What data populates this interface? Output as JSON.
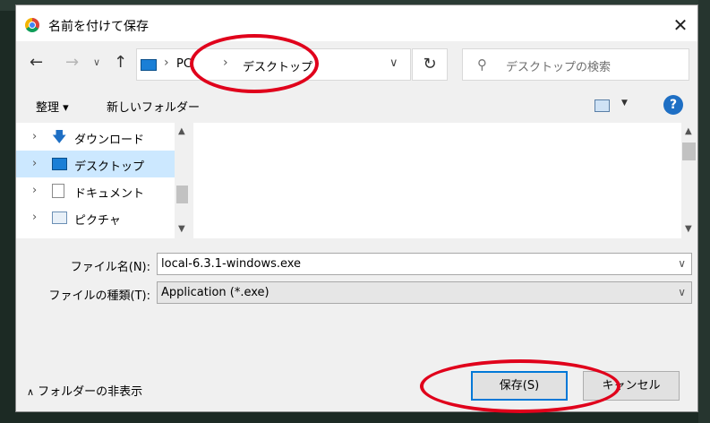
{
  "dialog": {
    "title": "名前を付けて保存"
  },
  "address": {
    "crumb_pc": "PC",
    "crumb_desktop": "デスクトップ"
  },
  "search": {
    "placeholder": "デスクトップの検索"
  },
  "toolbar": {
    "organize": "整理 ▾",
    "new_folder": "新しいフォルダー"
  },
  "tree": {
    "items": [
      {
        "label": "ダウンロード",
        "icon": "download-icon"
      },
      {
        "label": "デスクトップ",
        "icon": "desktop-icon",
        "selected": true
      },
      {
        "label": "ドキュメント",
        "icon": "documents-icon"
      },
      {
        "label": "ピクチャ",
        "icon": "pictures-icon"
      }
    ]
  },
  "form": {
    "filename_label": "ファイル名(N):",
    "filename_value": "local-6.3.1-windows.exe",
    "filetype_label": "ファイルの種類(T):",
    "filetype_value": "Application (*.exe)"
  },
  "footer": {
    "toggle_folders": "フォルダーの非表示",
    "save_button": "保存(S)",
    "cancel_button": "キャンセル"
  },
  "colors": {
    "accent": "#0078d7",
    "annotation": "#e0001b",
    "selection": "#cce8ff"
  }
}
